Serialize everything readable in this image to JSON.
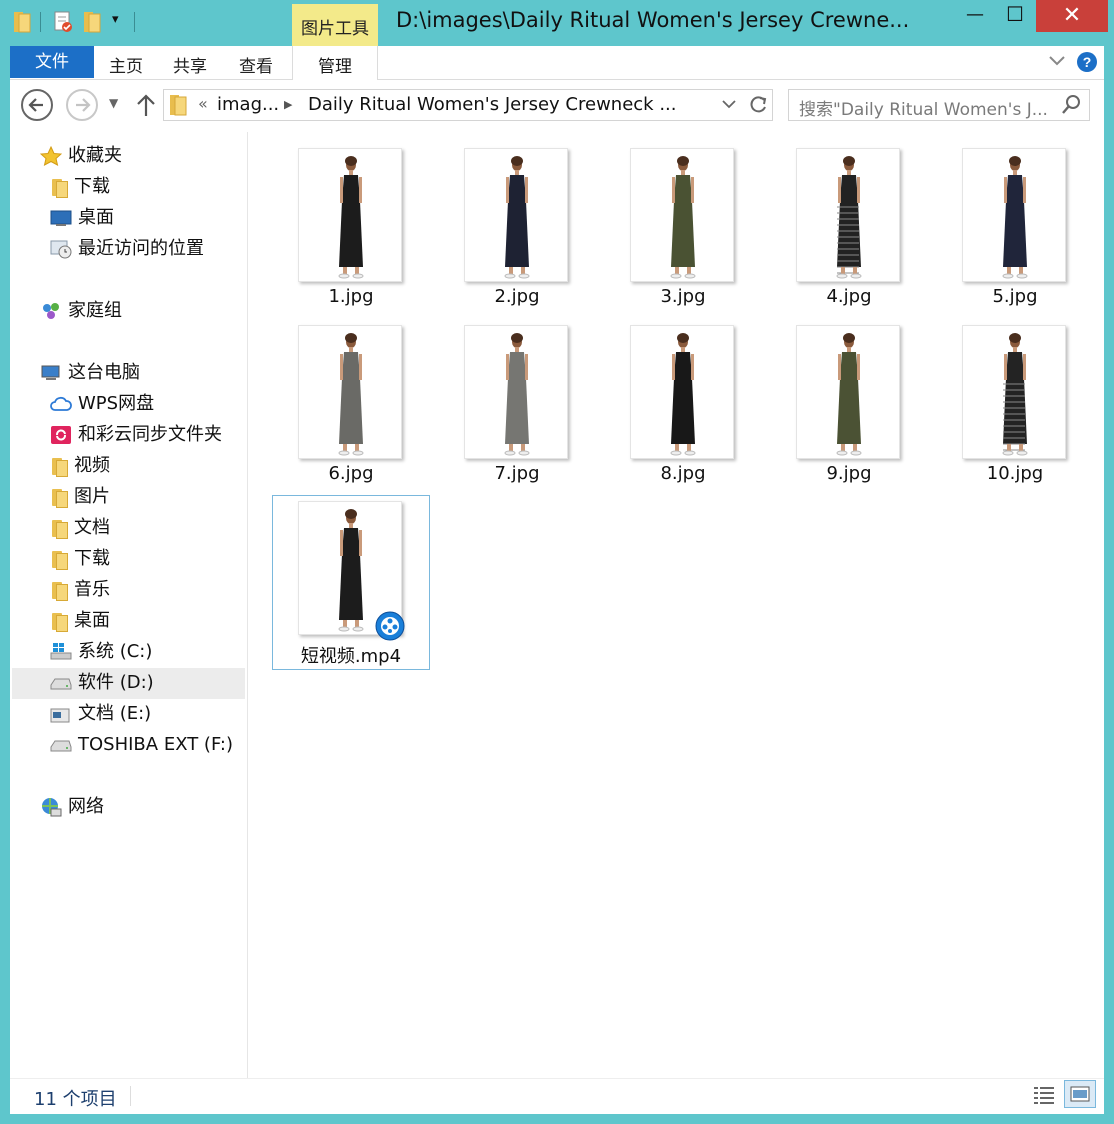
{
  "titlebar": {
    "tools_tab_label": "图片工具",
    "window_title": "D:\\images\\Daily Ritual Women's Jersey Crewne...",
    "minimize": "—",
    "maximize": "☐",
    "close": "✕"
  },
  "ribbon": {
    "file_tab": "文件",
    "tabs": [
      "主页",
      "共享",
      "查看"
    ],
    "manage_tab": "管理"
  },
  "address": {
    "chevron": "«",
    "crumbs": [
      "imag...",
      "Daily Ritual Women's Jersey Crewneck ..."
    ],
    "search_placeholder": "搜索\"Daily Ritual Women's J..."
  },
  "navpane": {
    "favorites": {
      "title": "收藏夹",
      "items": [
        "下载",
        "桌面",
        "最近访问的位置"
      ]
    },
    "homegroup": "家庭组",
    "thispc": {
      "title": "这台电脑",
      "items": [
        "WPS网盘",
        "和彩云同步文件夹",
        "视频",
        "图片",
        "文档",
        "下载",
        "音乐",
        "桌面",
        "系统 (C:)",
        "软件 (D:)",
        "文档 (E:)",
        "TOSHIBA EXT (F:)"
      ]
    },
    "network": "网络",
    "selected_item": "软件 (D:)"
  },
  "files": [
    {
      "name": "1.jpg",
      "dress": "#1c1c1c",
      "stripes": false
    },
    {
      "name": "2.jpg",
      "dress": "#1e2233",
      "stripes": false
    },
    {
      "name": "3.jpg",
      "dress": "#4a5233",
      "stripes": false
    },
    {
      "name": "4.jpg",
      "dress": "#222222",
      "stripes": true
    },
    {
      "name": "5.jpg",
      "dress": "#20253a",
      "stripes": false
    },
    {
      "name": "6.jpg",
      "dress": "#6a6a66",
      "stripes": false
    },
    {
      "name": "7.jpg",
      "dress": "#767672",
      "stripes": false
    },
    {
      "name": "8.jpg",
      "dress": "#181818",
      "stripes": false
    },
    {
      "name": "9.jpg",
      "dress": "#4b5234",
      "stripes": false
    },
    {
      "name": "10.jpg",
      "dress": "#232323",
      "stripes": true
    },
    {
      "name": "短视频.mp4",
      "dress": "#1c1c1c",
      "stripes": false,
      "video": true
    }
  ],
  "status": {
    "item_count": "11 个项目"
  },
  "colors": {
    "window_frame": "#5ec6cc",
    "file_tab": "#1c6fc7",
    "tools_tab": "#f3ea8a",
    "close_button": "#c9403a",
    "selection_border": "#7ab8dd"
  }
}
